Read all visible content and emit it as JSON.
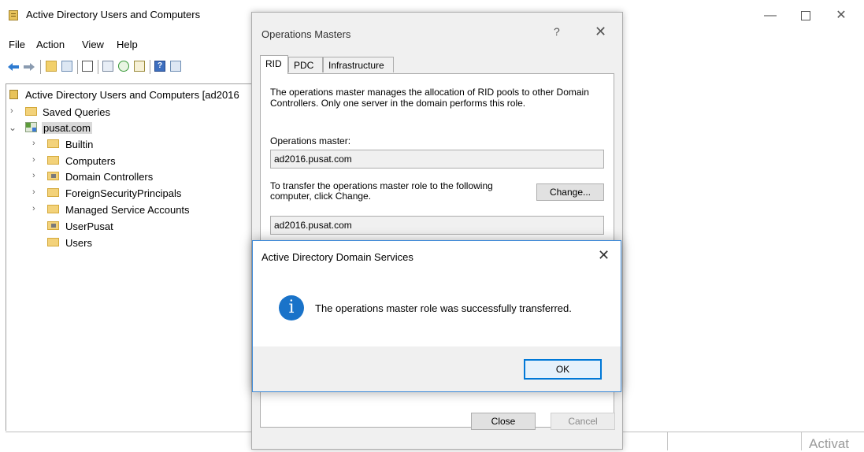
{
  "app": {
    "title": "Active Directory Users and Computers",
    "menu": [
      "File",
      "Action",
      "View",
      "Help"
    ]
  },
  "tree": {
    "root_label": "Active Directory Users and Computers [ad2016",
    "saved_queries": "Saved Queries",
    "domain": "pusat.com",
    "children": [
      {
        "label": "Builtin",
        "has_children": true,
        "icon": "folder-icon"
      },
      {
        "label": "Computers",
        "has_children": true,
        "icon": "folder-icon"
      },
      {
        "label": "Domain Controllers",
        "has_children": true,
        "icon": "ou-folder-icon"
      },
      {
        "label": "ForeignSecurityPrincipals",
        "has_children": true,
        "icon": "folder-icon"
      },
      {
        "label": "Managed Service Accounts",
        "has_children": true,
        "icon": "folder-icon"
      },
      {
        "label": "UserPusat",
        "has_children": false,
        "icon": "ou-folder-icon"
      },
      {
        "label": "Users",
        "has_children": false,
        "icon": "folder-icon"
      }
    ]
  },
  "watermark": {
    "text": "Activat"
  },
  "operations_masters": {
    "title": "Operations Masters",
    "help": "?",
    "tabs": [
      "RID",
      "PDC",
      "Infrastructure"
    ],
    "active_tab": "RID",
    "description": "The operations master manages the allocation of RID pools to other Domain Controllers. Only one server in the domain performs this role.",
    "operations_master_label": "Operations master:",
    "operations_master_value": "ad2016.pusat.com",
    "transfer_text": "To transfer the operations master role to the following computer, click Change.",
    "change_button": "Change...",
    "target_value": "ad2016.pusat.com",
    "close_button": "Close",
    "cancel_button": "Cancel"
  },
  "message_box": {
    "title": "Active Directory Domain Services",
    "message": "The operations master role was successfully transferred.",
    "ok_button": "OK",
    "icon": "info-icon"
  },
  "colors": {
    "accent": "#0078d7",
    "info_icon": "#1a73c9",
    "dialog_bg": "#f0f0f0"
  }
}
